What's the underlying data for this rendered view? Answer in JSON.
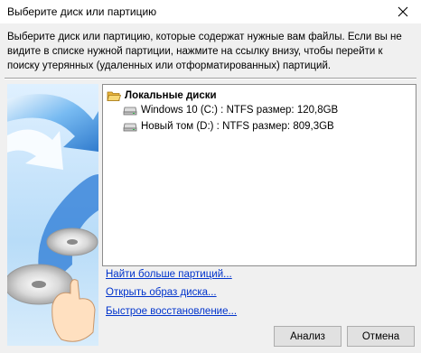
{
  "window": {
    "title": "Выберите диск или партицию"
  },
  "instructions": "Выберите диск или партицию, которые содержат нужные вам файлы. Если вы не видите в списке нужной партиции, нажмите на ссылку внизу, чтобы перейти к поиску утерянных (удаленных или отформатированных) партиций.",
  "tree": {
    "root_label": "Локальные диски",
    "items": [
      {
        "label": "Windows 10 (C:) : NTFS размер: 120,8GB",
        "icon": "drive-icon"
      },
      {
        "label": "Новый том (D:) : NTFS размер: 809,3GB",
        "icon": "drive-icon"
      }
    ]
  },
  "links": {
    "find_more": "Найти больше партиций...",
    "open_image": "Открыть образ диска...",
    "quick_restore": "Быстрое восстановление..."
  },
  "buttons": {
    "analyze": "Анализ",
    "cancel": "Отмена"
  },
  "colors": {
    "link": "#0033cc",
    "sidebar_blue": "#3c8de0",
    "folder": "#f5c542"
  }
}
